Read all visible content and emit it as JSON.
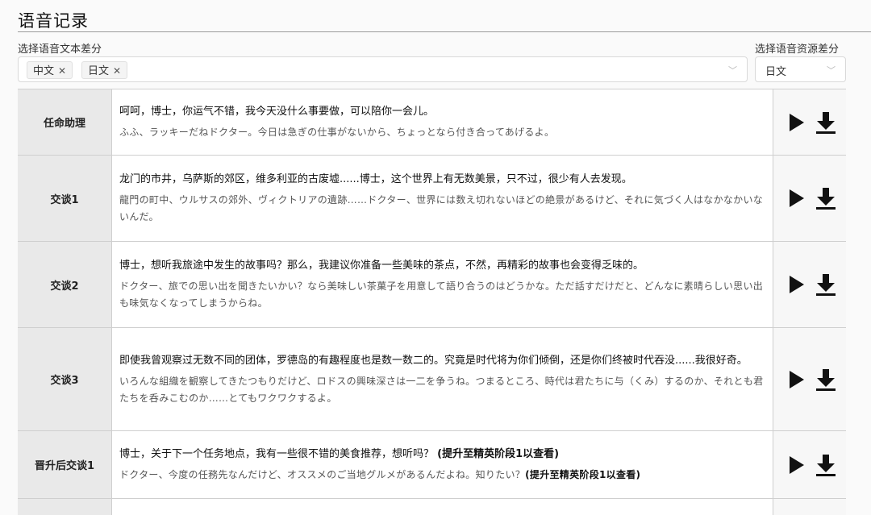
{
  "page": {
    "title": "语音记录"
  },
  "filters": {
    "text_diff_label": "选择语音文本差分",
    "text_diff_tags": [
      "中文",
      "日文"
    ],
    "resource_diff_label": "选择语音资源差分",
    "resource_diff_value": "日文"
  },
  "icons": {
    "tag_remove": "close-icon",
    "dropdown": "chevron-down-icon",
    "play": "play-icon",
    "download": "download-icon"
  },
  "rows": [
    {
      "label": "任命助理",
      "cn": "呵呵，博士，你运气不错，我今天没什么事要做，可以陪你一会儿。",
      "cn_note": "",
      "jp": "ふふ、ラッキーだねドクター。今日は急ぎの仕事がないから、ちょっとなら付き合ってあげるよ。",
      "jp_note": ""
    },
    {
      "label": "交谈1",
      "cn": "龙门的市井，乌萨斯的郊区，维多利亚的古废墟......博士，这个世界上有无数美景，只不过，很少有人去发现。",
      "cn_note": "",
      "jp": "龍門の町中、ウルサスの郊外、ヴィクトリアの遺跡……ドクター、世界には数え切れないほどの絶景があるけど、それに気づく人はなかなかいないんだ。",
      "jp_note": ""
    },
    {
      "label": "交谈2",
      "cn": "博士，想听我旅途中发生的故事吗？那么，我建议你准备一些美味的茶点，不然，再精彩的故事也会变得乏味的。",
      "cn_note": "",
      "jp": "ドクター、旅での思い出を聞きたいかい？なら美味しい茶菓子を用意して語り合うのはどうかな。ただ話すだけだと、どんなに素晴らしい思い出も味気なくなってしまうからね。",
      "jp_note": ""
    },
    {
      "label": "交谈3",
      "cn": "即使我曾观察过无数不同的团体，罗德岛的有趣程度也是数一数二的。究竟是时代将为你们倾倒，还是你们终被时代吞没......我很好奇。",
      "cn_note": "",
      "jp": "いろんな組織を観察してきたつもりだけど、ロドスの興味深さは一二を争うね。つまるところ、時代は君たちに与（くみ）するのか、それとも君たちを呑みこむのか……とてもワクワクするよ。",
      "jp_note": ""
    },
    {
      "label": "晋升后交谈1",
      "cn": "博士，关于下一个任务地点，我有一些很不错的美食推荐，想听吗？",
      "cn_note": "(提升至精英阶段1以查看)",
      "jp": "ドクター、今度の任務先なんだけど、オススメのご当地グルメがあるんだよね。知りたい？",
      "jp_note": "(提升至精英阶段1以查看)"
    }
  ]
}
